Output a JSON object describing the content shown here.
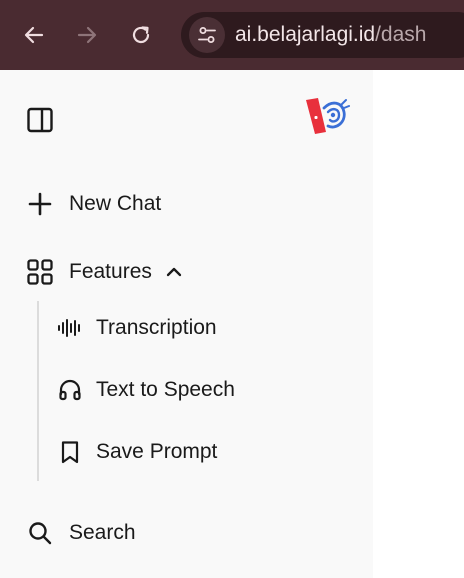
{
  "browser": {
    "back_icon": "arrow-left-icon",
    "forward_icon": "arrow-right-icon",
    "reload_icon": "reload-icon",
    "site_info_icon": "tune-icon",
    "url_domain": "ai.belajarlagi.id",
    "url_path": "/dash",
    "colors": {
      "bar": "#4a2b31",
      "omnibox": "#2e1a1e",
      "url_text": "#f3e6e8"
    }
  },
  "sidebar": {
    "toggle_icon": "sidebar-panel-icon",
    "logo_icon": "belajarlagi-logo",
    "new_chat": {
      "icon": "plus-icon",
      "label": "New Chat"
    },
    "features": {
      "icon": "grid-icon",
      "label": "Features",
      "expanded_icon": "chevron-up-icon",
      "items": [
        {
          "icon": "waveform-icon",
          "label": "Transcription"
        },
        {
          "icon": "headphones-icon",
          "label": "Text to Speech"
        },
        {
          "icon": "bookmark-icon",
          "label": "Save Prompt"
        }
      ]
    },
    "search": {
      "icon": "search-icon",
      "label": "Search"
    },
    "colors": {
      "background": "#f9f9f9",
      "logo_red": "#e8303c",
      "logo_blue": "#3b6fd6"
    }
  }
}
